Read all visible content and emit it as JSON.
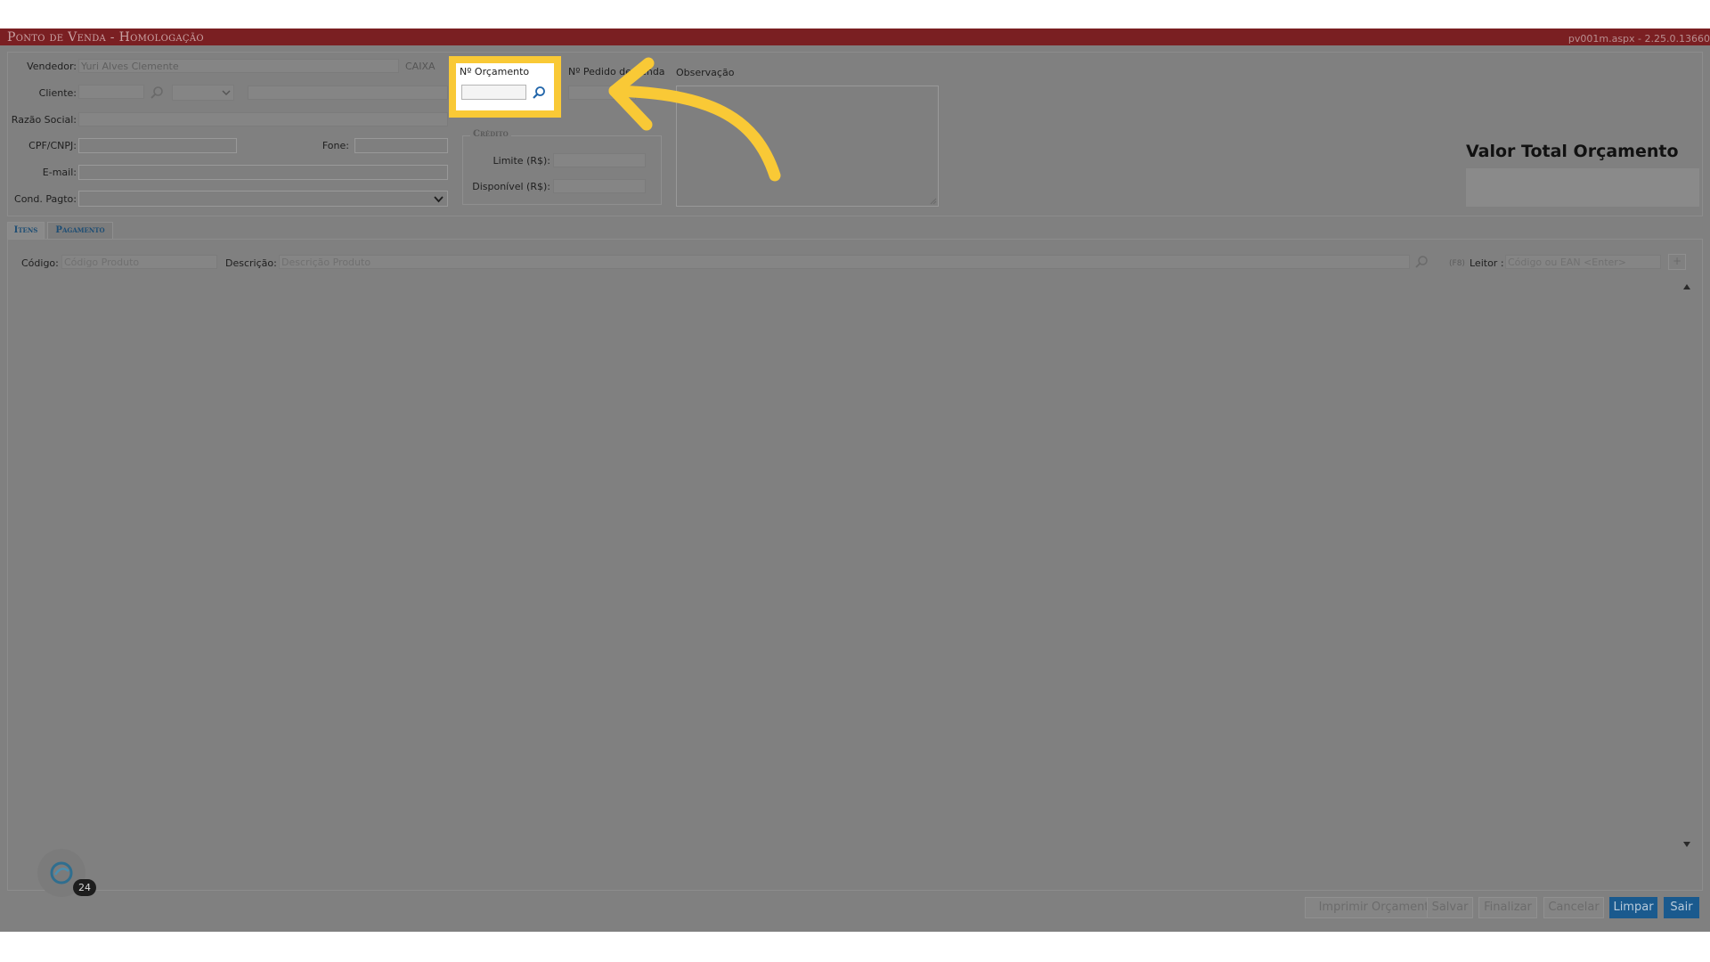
{
  "window": {
    "title": "Ponto de Venda  - Homologação",
    "version": "pv001m.aspx - 2.25.0.13660"
  },
  "form": {
    "vendedor_label": "Vendedor:",
    "vendedor_value": "Yuri Alves Clemente",
    "caixa_label": "CAIXA",
    "cliente_label": "Cliente:",
    "razao_social_label": "Razão Social:",
    "cpf_cnpj_label": "CPF/CNPJ:",
    "fone_label": "Fone:",
    "email_label": "E-mail:",
    "cond_pagto_label": "Cond. Pagto:",
    "orcamento_label": "Nº Orçamento",
    "orcamento_value": "",
    "pedido_label": "Nº Pedido de Venda",
    "observacao_label": "Observação",
    "credito": {
      "legend": "Crédito",
      "limite_label": "Limite (R$):",
      "disponivel_label": "Disponível (R$):"
    },
    "valor_total_label": "Valor Total Orçamento"
  },
  "tabs": [
    {
      "label": "Itens",
      "active": true
    },
    {
      "label": "Pagamento",
      "active": false
    }
  ],
  "items": {
    "codigo_label": "Código:",
    "codigo_placeholder": "Código Produto",
    "descricao_label": "Descrição:",
    "descricao_placeholder": "Descrição Produto",
    "leitor_hint": "(F8)",
    "leitor_label": "Leitor :",
    "leitor_placeholder": "Código ou EAN <Enter>",
    "add_label": "+"
  },
  "buttons": {
    "imprimir": "Imprimir Orçamento",
    "salvar": "Salvar",
    "finalizar": "Finalizar",
    "cancelar": "Cancelar",
    "limpar": "Limpar",
    "sair": "Sair"
  },
  "assistant": {
    "badge": "24"
  },
  "colors": {
    "titlebar": "#7a1f22",
    "highlight": "#f9c936",
    "primary_button": "#1a5a8e",
    "overlay": "#808080"
  },
  "icons": [
    "search-icon",
    "chevron-down-icon",
    "arrow-up-icon",
    "arrow-down-icon",
    "assistant-icon"
  ]
}
